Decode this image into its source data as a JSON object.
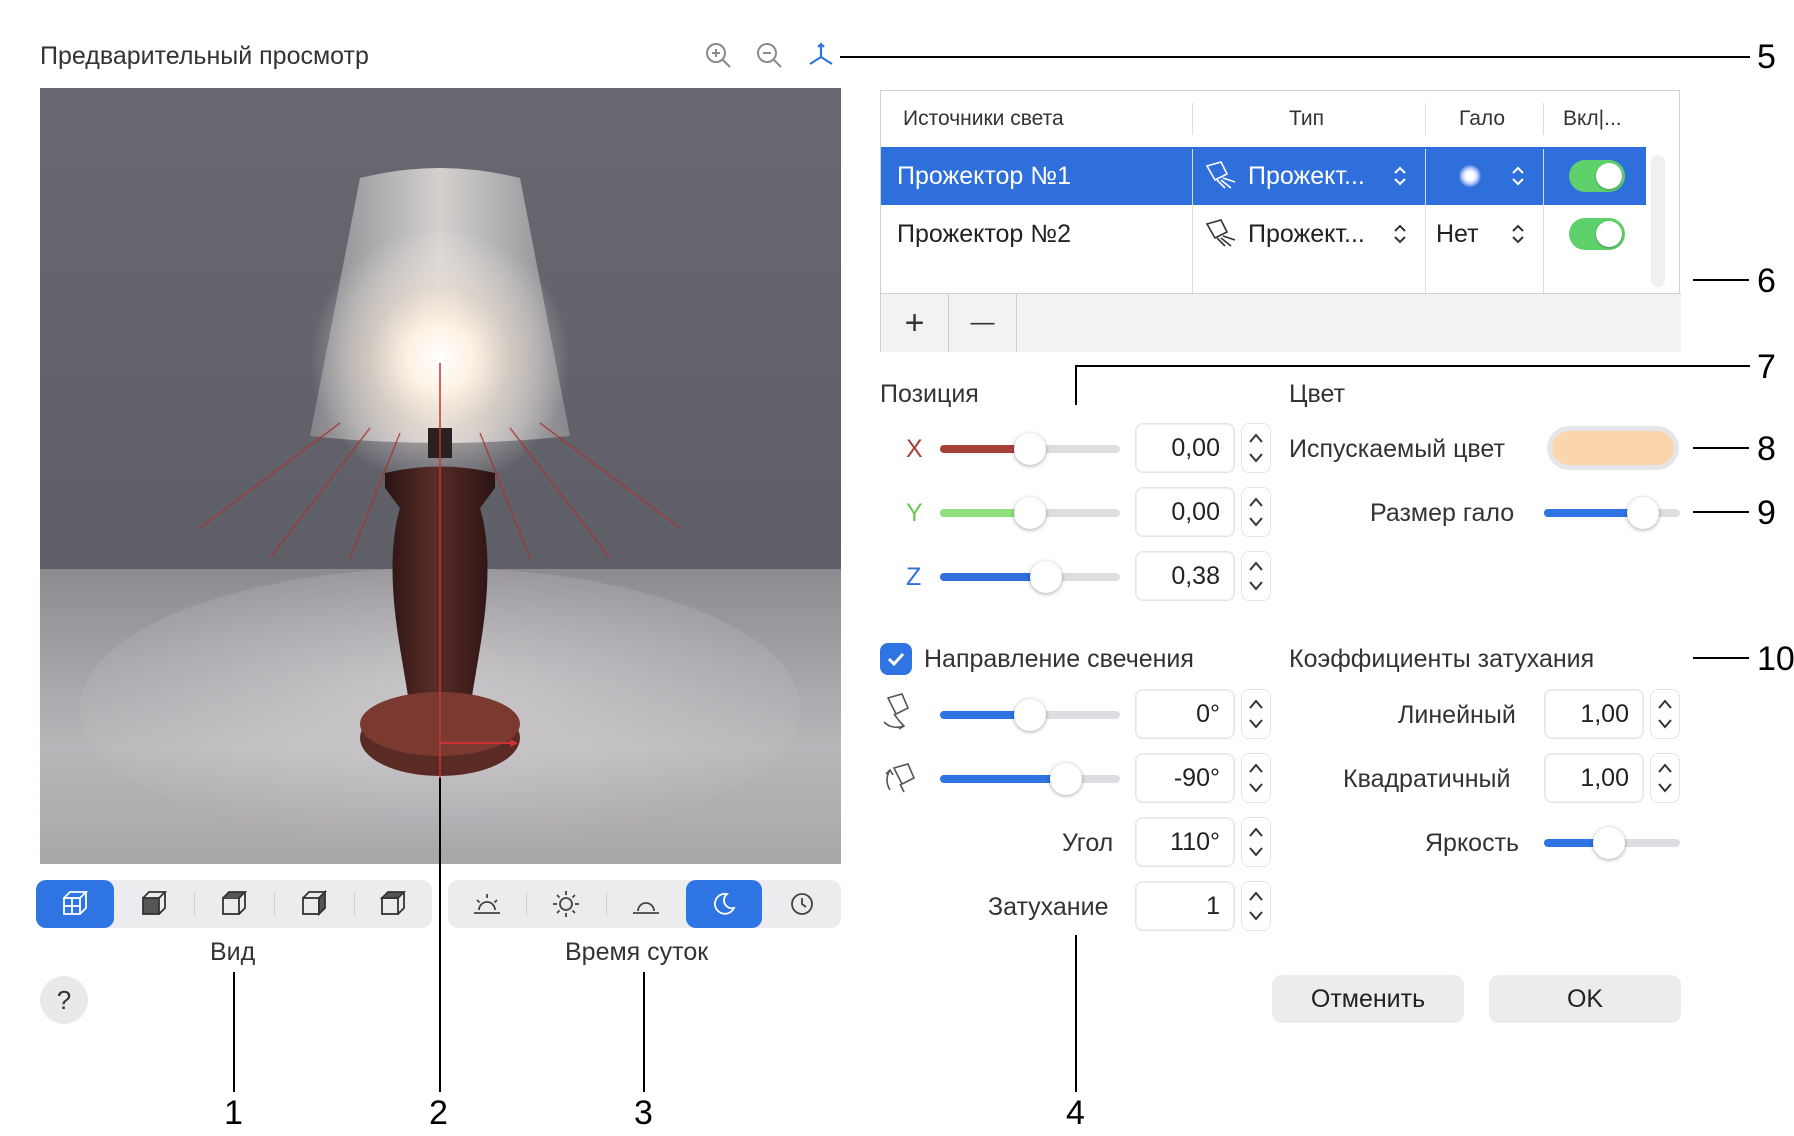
{
  "preview": {
    "title": "Предварительный просмотр",
    "icons": [
      "zoom-in-icon",
      "zoom-out-icon",
      "axes-icon"
    ]
  },
  "view_segment": {
    "caption": "Вид",
    "items": [
      "cube-view-1-icon",
      "cube-view-2-icon",
      "cube-view-3-icon",
      "cube-view-4-icon",
      "cube-view-5-icon"
    ],
    "active_index": 0
  },
  "time_segment": {
    "caption": "Время суток",
    "items": [
      "sunrise-icon",
      "sun-icon",
      "sunset-icon",
      "moon-icon",
      "clock-icon"
    ],
    "active_index": 3
  },
  "help_label": "?",
  "lights_table": {
    "headers": {
      "name": "Источники света",
      "type": "Тип",
      "halo": "Гало",
      "on": "Вкл|..."
    },
    "rows": [
      {
        "name": "Прожектор №1",
        "type": "Прожект...",
        "halo": "",
        "on": true,
        "selected": true
      },
      {
        "name": "Прожектор №2",
        "type": "Прожект...",
        "halo": "Нет",
        "on": true,
        "selected": false
      }
    ],
    "add_label": "+",
    "remove_label": "—"
  },
  "position": {
    "title": "Позиция",
    "x": {
      "label": "X",
      "value": "0,00",
      "slider": 0.5,
      "color": "#a8403a"
    },
    "y": {
      "label": "Y",
      "value": "0,00",
      "slider": 0.5,
      "color": "#8fe07a"
    },
    "z": {
      "label": "Z",
      "value": "0,38",
      "slider": 0.59,
      "color": "#2f6fdb"
    }
  },
  "color": {
    "title": "Цвет",
    "emitted_label": "Испускаемый цвет",
    "emitted_value": "#fbd6ad",
    "halo_size_label": "Размер гало",
    "halo_size_slider": 0.73
  },
  "direction": {
    "checkbox_label": "Направление свечения",
    "checked": true,
    "rot1": {
      "value": "0°",
      "slider": 0.5
    },
    "rot2": {
      "value": "-90°",
      "slider": 0.7
    },
    "angle_label": "Угол",
    "angle_value": "110°",
    "falloff_label": "Затухание",
    "falloff_value": "1"
  },
  "attenuation": {
    "title": "Коэффициенты затухания",
    "linear_label": "Линейный",
    "linear_value": "1,00",
    "quadratic_label": "Квадратичный",
    "quadratic_value": "1,00",
    "brightness_label": "Яркость",
    "brightness_slider": 0.48
  },
  "buttons": {
    "cancel": "Отменить",
    "ok": "OK"
  },
  "callouts": [
    "1",
    "2",
    "3",
    "4",
    "5",
    "6",
    "7",
    "8",
    "9",
    "10"
  ],
  "accent": "#2f74e3"
}
